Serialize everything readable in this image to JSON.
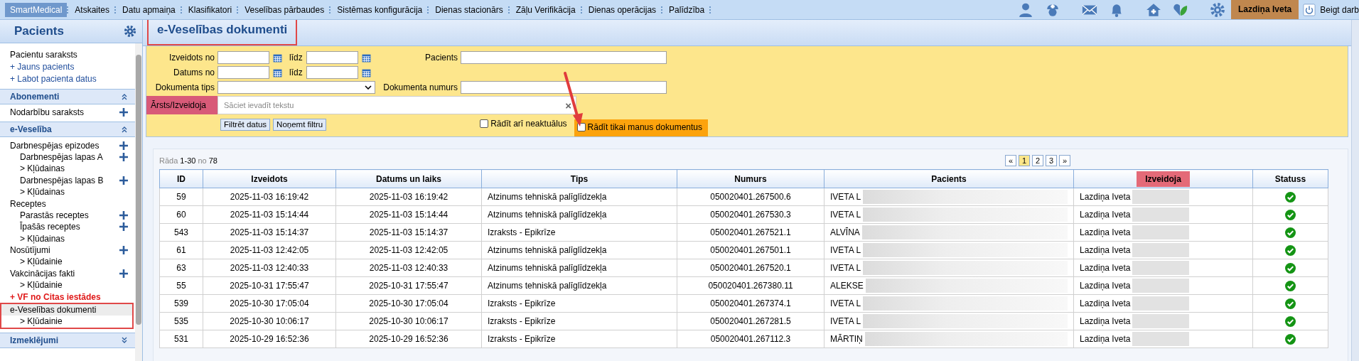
{
  "menu": [
    {
      "label": "SmartMedical",
      "kind": "brand"
    },
    {
      "label": "Atskaites",
      "kind": "item"
    },
    {
      "label": "Datu apmaiņa",
      "kind": "item"
    },
    {
      "label": "Klasifikatori",
      "kind": "item"
    },
    {
      "label": "Veselības pārbaudes",
      "kind": "item"
    },
    {
      "label": "Sistēmas konfigurācija",
      "kind": "item"
    },
    {
      "label": "Dienas stacionārs",
      "kind": "item"
    },
    {
      "label": "Zāļu Verifikācija",
      "kind": "item"
    },
    {
      "label": "Dienas operācijas",
      "kind": "item"
    },
    {
      "label": "Palīdzība",
      "kind": "item"
    }
  ],
  "user": {
    "name": "Lazdiņa Iveta",
    "logout": "Beigt darb"
  },
  "sidebar": {
    "title": "Pacients",
    "links": [
      {
        "label": "Pacientu saraksts",
        "kind": "item"
      },
      {
        "label": "+ Jauns pacients",
        "kind": "link"
      },
      {
        "label": "+ Labot pacienta datus",
        "kind": "link"
      }
    ],
    "sections": [
      {
        "title": "Abonementi",
        "expanded": true,
        "items": [
          {
            "label": "Nodarbību saraksts",
            "kind": "item",
            "add": true,
            "selected": false
          }
        ]
      },
      {
        "title": "e-Veselība",
        "expanded": true,
        "items": [
          {
            "label": "Darbnespējas epizodes",
            "kind": "item",
            "add": true,
            "selected": false,
            "children": [
              {
                "label": "Darbnespējas lapas A",
                "add": true,
                "selected": false
              },
              {
                "label": "> Kļūdainas",
                "add": false,
                "selected": false
              },
              {
                "label": "Darbnespējas lapas B",
                "add": true,
                "selected": false
              },
              {
                "label": "> Kļūdainas",
                "add": false,
                "selected": false
              }
            ]
          },
          {
            "label": "Receptes",
            "kind": "item",
            "add": false,
            "selected": false,
            "children": [
              {
                "label": "Parastās receptes",
                "add": true,
                "selected": false
              },
              {
                "label": "Īpašās receptes",
                "add": true,
                "selected": false
              },
              {
                "label": "> Kļūdainas",
                "add": false,
                "selected": false
              }
            ]
          },
          {
            "label": "Nosūtījumi",
            "kind": "item",
            "add": true,
            "selected": false,
            "children": [
              {
                "label": "> Kļūdainie",
                "add": false,
                "selected": false
              }
            ]
          },
          {
            "label": "Vakcinācijas fakti",
            "kind": "item",
            "add": true,
            "selected": false,
            "children": [
              {
                "label": "> Kļūdainie",
                "add": false,
                "selected": false
              }
            ]
          },
          {
            "label": "+ VF no Citas iestādes",
            "kind": "alert",
            "add": false,
            "selected": false
          },
          {
            "label": "e-Veselības dokumenti",
            "kind": "item",
            "add": false,
            "selected": true,
            "highlighted": true,
            "children": [
              {
                "label": "> Kļūdainie",
                "add": false,
                "selected": false
              }
            ]
          }
        ]
      },
      {
        "title": "Izmeklējumi",
        "expanded": false
      }
    ]
  },
  "page": {
    "title": "e-Veselības dokumenti",
    "title_highlighted": true
  },
  "filters": {
    "created_from": "Izveidots no",
    "to_1": "līdz",
    "date_from": "Datums no",
    "to_2": "līdz",
    "patient": "Pacients",
    "doc_type": "Dokumenta tips",
    "doc_number": "Dokumenta numurs",
    "author": {
      "label": "Ārsts/Izveidoja",
      "placeholder": "Sāciet ievadīt tekstu",
      "clear": "×",
      "highlighted": true
    },
    "filter_button": "Filtrēt datus",
    "clear_button": "Noņemt filtru",
    "options": [
      {
        "label": "Rādīt arī neaktuālus",
        "checked": false,
        "highlighted": false,
        "pointer": false
      },
      {
        "label": "Rādīt tikai manus dokumentus",
        "checked": false,
        "highlighted": true,
        "pointer": true
      }
    ]
  },
  "summary": {
    "prefix": "Rāda",
    "range": "1-30",
    "middle": "no",
    "total": "78"
  },
  "pages": [
    {
      "label": "«",
      "selected": false
    },
    {
      "label": "1",
      "selected": true
    },
    {
      "label": "2",
      "selected": false
    },
    {
      "label": "3",
      "selected": false
    },
    {
      "label": "»",
      "selected": false
    }
  ],
  "table": {
    "columns": [
      {
        "label": "ID",
        "highlighted": false
      },
      {
        "label": "Izveidots",
        "highlighted": false
      },
      {
        "label": "Datums un laiks",
        "highlighted": false
      },
      {
        "label": "Tips",
        "highlighted": false
      },
      {
        "label": "Numurs",
        "highlighted": false
      },
      {
        "label": "Pacients",
        "highlighted": false
      },
      {
        "label": "Izveidoja",
        "highlighted": true
      },
      {
        "label": "Statuss",
        "highlighted": false
      }
    ],
    "rows": [
      {
        "id": "59",
        "created": "2025-11-03 16:19:42",
        "date": "2025-11-03 16:19:42",
        "type": "Atzinums tehniskā palīglīdzekļa",
        "number": "050020401.267500.6",
        "patient": "IVETA L",
        "author": "Lazdiņa Iveta",
        "valid": true
      },
      {
        "id": "60",
        "created": "2025-11-03 15:14:44",
        "date": "2025-11-03 15:14:44",
        "type": "Atzinums tehniskā palīglīdzekļa",
        "number": "050020401.267530.3",
        "patient": "IVETA L",
        "author": "Lazdiņa Iveta",
        "valid": true
      },
      {
        "id": "543",
        "created": "2025-11-03 15:14:37",
        "date": "2025-11-03 15:14:37",
        "type": "Izraksts - Epikrīze",
        "number": "050020401.267521.1",
        "patient": "ALVĪNA",
        "author": "Lazdiņa Iveta",
        "valid": true
      },
      {
        "id": "61",
        "created": "2025-11-03 12:42:05",
        "date": "2025-11-03 12:42:05",
        "type": "Atzinums tehniskā palīglīdzekļa",
        "number": "050020401.267501.1",
        "patient": "IVETA L",
        "author": "Lazdiņa Iveta",
        "valid": true
      },
      {
        "id": "63",
        "created": "2025-11-03 12:40:33",
        "date": "2025-11-03 12:40:33",
        "type": "Atzinums tehniskā palīglīdzekļa",
        "number": "050020401.267520.1",
        "patient": "IVETA L",
        "author": "Lazdiņa Iveta",
        "valid": true
      },
      {
        "id": "55",
        "created": "2025-10-31 17:55:47",
        "date": "2025-10-31 17:55:47",
        "type": "Atzinums tehniskā palīglīdzekļa",
        "number": "050020401.267380.11",
        "patient": "ALEKSE",
        "author": "Lazdiņa Iveta",
        "valid": true
      },
      {
        "id": "539",
        "created": "2025-10-30 17:05:04",
        "date": "2025-10-30 17:05:04",
        "type": "Izraksts - Epikrīze",
        "number": "050020401.267374.1",
        "patient": "IVETA L",
        "author": "Lazdiņa Iveta",
        "valid": true
      },
      {
        "id": "535",
        "created": "2025-10-30 10:06:17",
        "date": "2025-10-30 10:06:17",
        "type": "Izraksts - Epikrīze",
        "number": "050020401.267281.5",
        "patient": "IVETA L",
        "author": "Lazdiņa Iveta",
        "valid": true
      },
      {
        "id": "531",
        "created": "2025-10-29 16:52:36",
        "date": "2025-10-29 16:52:36",
        "type": "Izraksts - Epikrīze",
        "number": "050020401.267112.3",
        "patient": "MĀRTIŅ",
        "author": "Lazdiņa Iveta",
        "valid": true
      }
    ]
  }
}
